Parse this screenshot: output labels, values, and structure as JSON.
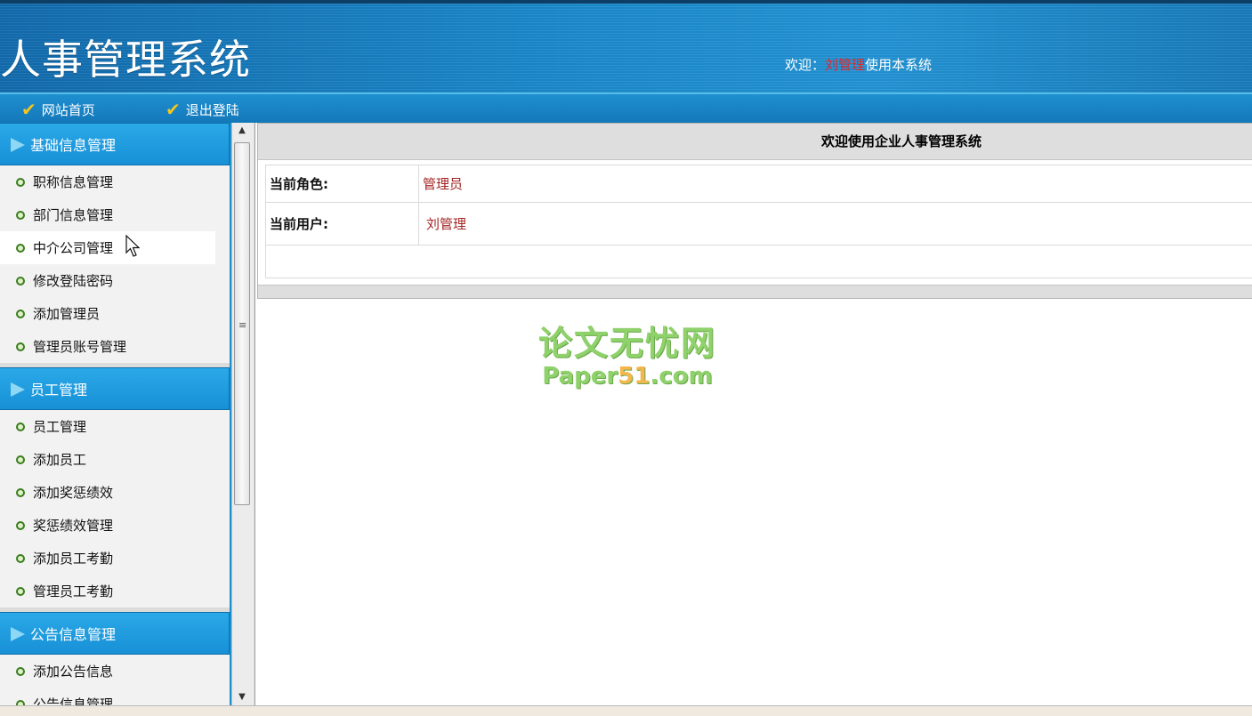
{
  "header": {
    "title": "人事管理系统",
    "welcome_prefix": "欢迎：",
    "welcome_user": "刘管理",
    "welcome_suffix": "使用本系统"
  },
  "nav": {
    "home_label": "网站首页",
    "logout_label": "退出登陆"
  },
  "sidebar": {
    "groups": [
      {
        "title": "基础信息管理",
        "items": [
          "职称信息管理",
          "部门信息管理",
          "中介公司管理",
          "修改登陆密码",
          "添加管理员",
          "管理员账号管理"
        ]
      },
      {
        "title": "员工管理",
        "items": [
          "员工管理",
          "添加员工",
          "添加奖惩绩效",
          "奖惩绩效管理",
          "添加员工考勤",
          "管理员工考勤"
        ]
      },
      {
        "title": "公告信息管理",
        "items": [
          "添加公告信息",
          "公告信息管理"
        ]
      }
    ]
  },
  "main": {
    "panel_title": "欢迎使用企业人事管理系统",
    "role_label": "当前角色:",
    "role_value": "管理员",
    "user_label": "当前用户:",
    "user_value": "刘管理"
  },
  "watermark": {
    "line1": "论文无忧网",
    "line2_a": "Paper",
    "line2_num": "51",
    "line2_b": ".com"
  },
  "colors": {
    "header_blue": "#1785c6",
    "menu_head_blue": "#1890d6",
    "username_red": "#e3262a",
    "value_red": "#a32323",
    "nav_check_yellow": "#f6c51b"
  }
}
